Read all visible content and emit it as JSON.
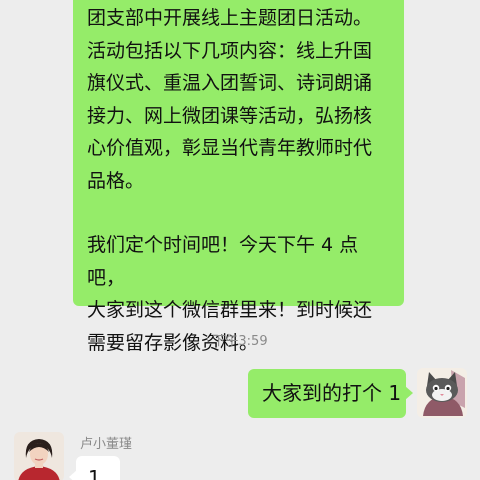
{
  "chat": {
    "messages": [
      {
        "sender": "self",
        "paragraphs": [
          "团支部中开展线上主题团日活动。\n活动包括以下几项内容：线上升国\n旗仪式、重温入团誓词、诗词朗诵\n接力、网上微团课等活动，弘扬核\n心价值观，彰显当代青年教师时代\n品格。",
          "我们定个时间吧！今天下午 4 点吧，\n大家到这个微信群里来！到时候还\n需要留存影像资料。"
        ]
      }
    ],
    "timestamp": "下午3:59",
    "self_message": "大家到的打个 1",
    "other_sender_name": "卢小董瑾",
    "other_message": "1"
  },
  "colors": {
    "chat_background": "#ededed",
    "sent_bubble": "#95ec69",
    "received_bubble": "#ffffff",
    "meta_text": "#8a8a8a"
  },
  "icons": {
    "self_avatar": "cartoon-cat-avatar",
    "other_avatar": "person-photo-avatar"
  }
}
